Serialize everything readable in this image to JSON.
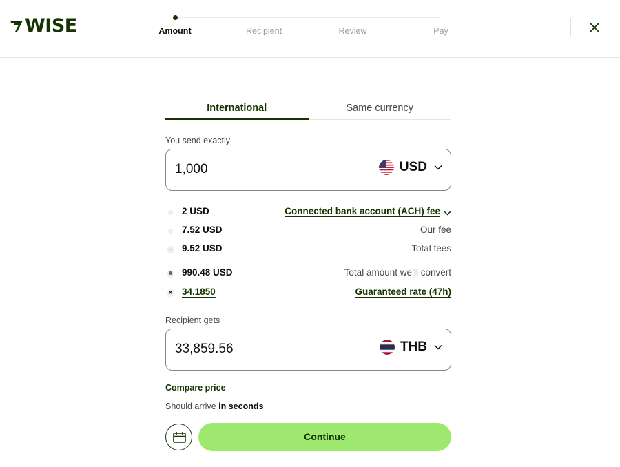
{
  "brand": {
    "logo_text": "WISE"
  },
  "stepper": {
    "steps": [
      "Amount",
      "Recipient",
      "Review",
      "Pay"
    ],
    "active_index": 0
  },
  "tabs": {
    "international": "International",
    "same_currency": "Same currency",
    "active": "International"
  },
  "send": {
    "label": "You send exactly",
    "amount": "1,000",
    "currency": "USD",
    "flag_icon": "us-flag-icon"
  },
  "fees": {
    "bank_fee_amount": "2 USD",
    "bank_fee_label": "Connected bank account (ACH) fee",
    "our_fee_amount": "7.52 USD",
    "our_fee_label": "Our fee",
    "total_fees_amount": "9.52 USD",
    "total_fees_label": "Total fees",
    "convert_amount": "990.48 USD",
    "convert_label": "Total amount we’ll convert",
    "rate": "34.1850",
    "rate_label": "Guaranteed rate (47h)",
    "minus_symbol": "−",
    "equals_symbol": "=",
    "times_symbol": "×"
  },
  "receive": {
    "label": "Recipient gets",
    "amount": "33,859.56",
    "currency": "THB",
    "flag_icon": "thailand-flag-icon"
  },
  "compare_label": "Compare price",
  "arrival": {
    "prefix": "Should arrive",
    "emphasis": "in seconds"
  },
  "continue_label": "Continue",
  "colors": {
    "brand_green": "#163300",
    "accent_green": "#9fe870"
  }
}
